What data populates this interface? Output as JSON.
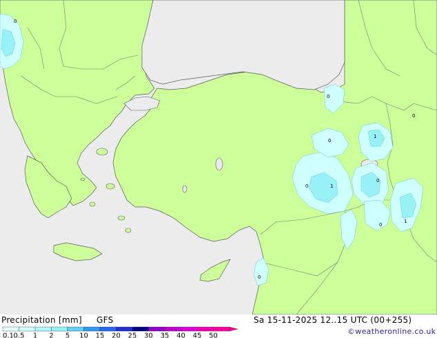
{
  "title": "Precipitation [mm]",
  "model": "GFS",
  "valid_time": "Sa 15-11-2025 12..15 UTC (00+255)",
  "credit": "©weatheronline.co.uk",
  "colors": {
    "land": "#ccff99",
    "sea": "#ececec",
    "coast": "#5a5a5a",
    "border": "#7a7a7a",
    "precip_light": "#cfffff",
    "precip_medium": "#97f1f7"
  },
  "legend": {
    "labels": [
      "0.1",
      "0.5",
      "1",
      "2",
      "5",
      "10",
      "15",
      "20",
      "25",
      "30",
      "35",
      "40",
      "45",
      "50"
    ],
    "colors": [
      "#e6ffff",
      "#cfffff",
      "#b1f6fb",
      "#97f1f7",
      "#62d1f4",
      "#3098f0",
      "#2a64e8",
      "#1f30d0",
      "#00007e",
      "#9000c8",
      "#c000d0",
      "#e000dc",
      "#f000b0",
      "#ff00a0"
    ]
  },
  "point_values": [
    "0",
    "0",
    "0",
    "1",
    "0",
    "1",
    "0",
    "0",
    "1",
    "0",
    "0"
  ]
}
